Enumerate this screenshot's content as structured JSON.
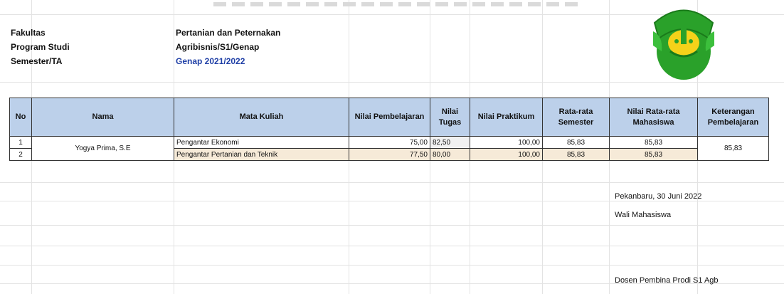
{
  "info": {
    "labels": [
      "Fakultas",
      "Program Studi",
      "Semester/TA"
    ],
    "values": [
      "Pertanian dan Peternakan",
      "Agribisnis/S1/Genap",
      "Genap 2021/2022"
    ]
  },
  "table": {
    "headers": [
      "No",
      "Nama",
      "Mata Kuliah",
      "Nilai Pembelajaran",
      "Nilai Tugas",
      "Nilai Praktikum",
      "Rata-rata Semester",
      "Nilai Rata-rata Mahasiswa",
      "Keterangan Pembelajaran"
    ],
    "rows": [
      {
        "no": "1",
        "mk": "Pengantar Ekonomi",
        "np": "75,00",
        "nt": "82,50",
        "npr": "100,00",
        "rs": "85,83",
        "rm": "85,83"
      },
      {
        "no": "2",
        "mk": "Pengantar Pertanian dan Teknik",
        "np": "77,50",
        "nt": "80,00",
        "npr": "100,00",
        "rs": "85,83",
        "rm": "85,83"
      }
    ],
    "merged_name": "Yogya Prima, S.E",
    "merged_keterangan": "85,83"
  },
  "side": {
    "date": "Pekanbaru, 30 Juni 2022",
    "role": "Wali Mahasiswa",
    "signature": "Dosen Pembina Prodi S1 Agb"
  },
  "colors": {
    "header_bg": "#bcd0ea",
    "accent_blue": "#1f3fa6",
    "logo_green": "#2aa12a",
    "logo_yellow": "#f5d21a"
  }
}
